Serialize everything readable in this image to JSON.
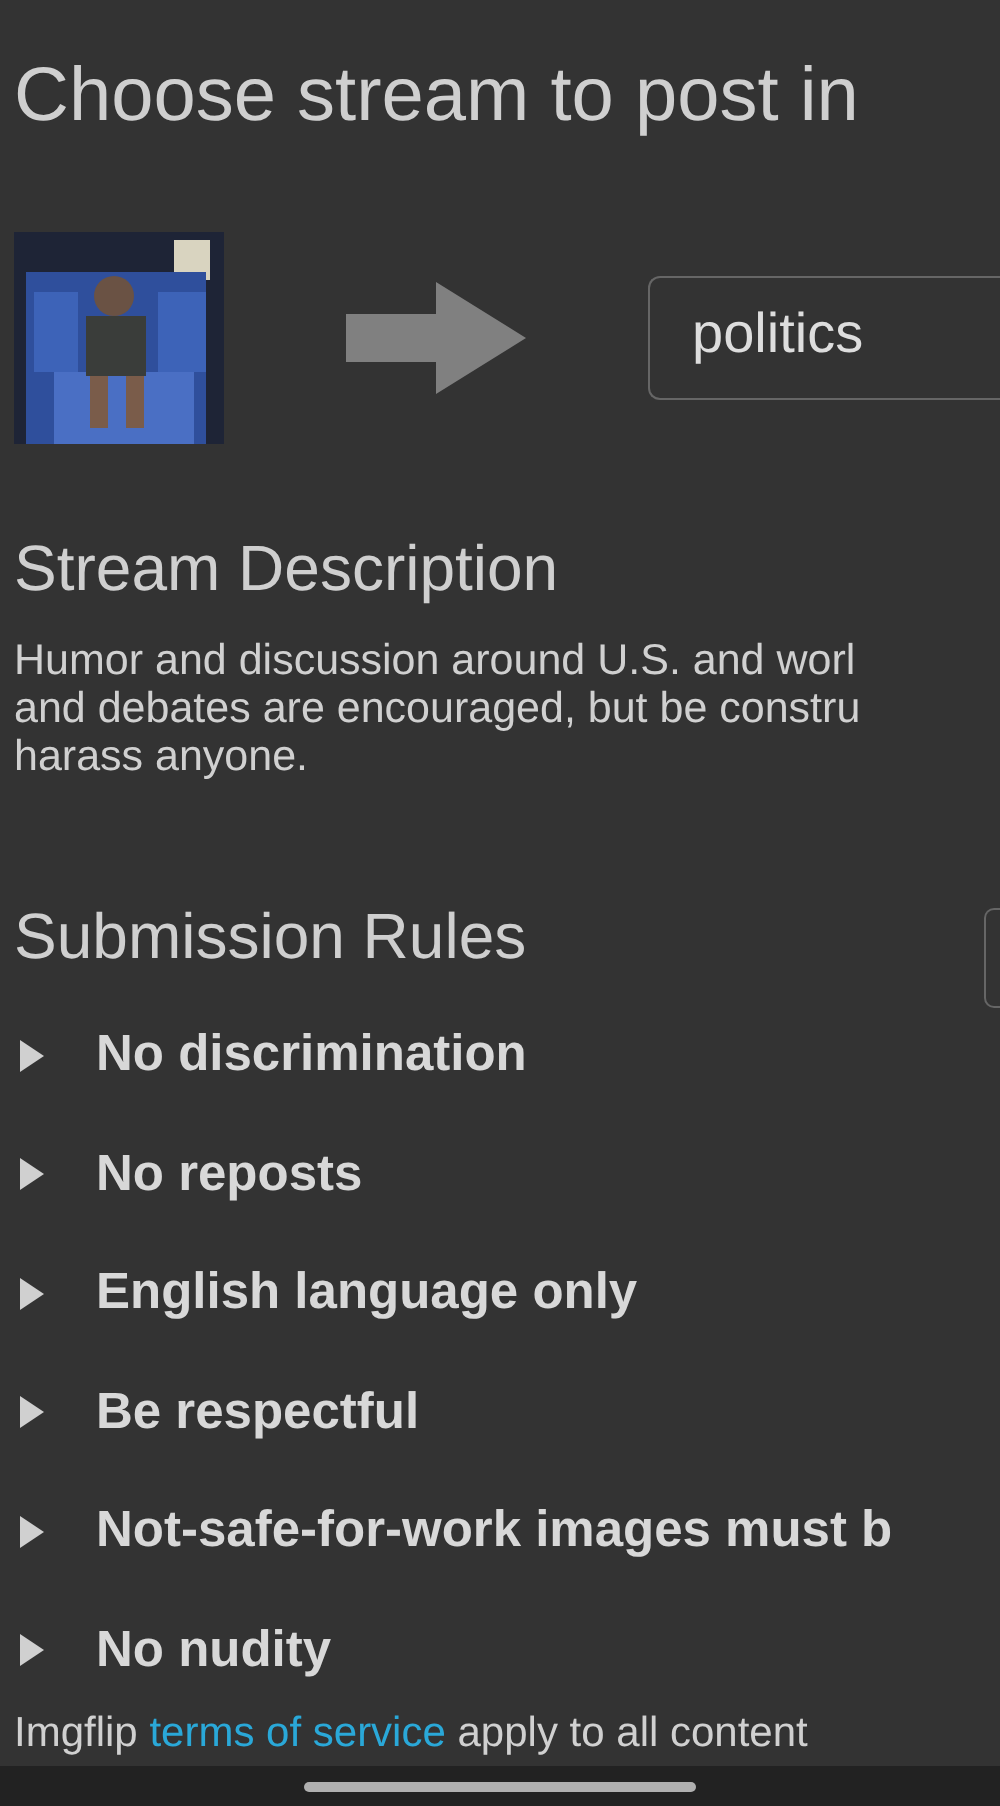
{
  "title": "Choose stream to post in",
  "stream_field": {
    "value": "politics"
  },
  "description": {
    "heading": "Stream Description",
    "lines": [
      "Humor and discussion around U.S. and worl",
      "and debates are encouraged, but be constru",
      "harass anyone."
    ]
  },
  "rules": {
    "heading": "Submission Rules",
    "items": [
      {
        "label": "No discrimination",
        "expanded": false
      },
      {
        "label": "No reposts",
        "expanded": false
      },
      {
        "label": "English language only",
        "expanded": false
      },
      {
        "label": "Be respectful",
        "expanded": false
      },
      {
        "label": "Not-safe-for-work images must b",
        "expanded": false
      },
      {
        "label": "No nudity",
        "expanded": false
      }
    ]
  },
  "footer": {
    "before": "Imgflip",
    "link": "terms of service",
    "after": "apply to all content"
  }
}
